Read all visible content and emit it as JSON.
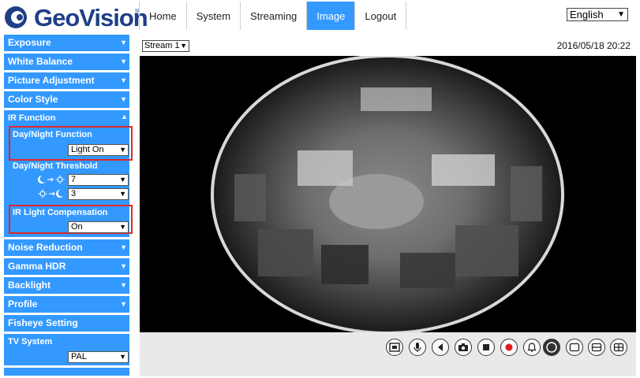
{
  "brand": {
    "name": "GeoVision",
    "suffix": "INC."
  },
  "nav": [
    {
      "label": "Home",
      "active": false
    },
    {
      "label": "System",
      "active": false
    },
    {
      "label": "Streaming",
      "active": false
    },
    {
      "label": "Image",
      "active": true
    },
    {
      "label": "Logout",
      "active": false
    }
  ],
  "language": {
    "selected": "English"
  },
  "sidebar": {
    "exposure": "Exposure",
    "white_balance": "White Balance",
    "picture_adjustment": "Picture Adjustment",
    "color_style": "Color Style",
    "ir_function": {
      "title": "IR Function",
      "day_night_function_label": "Day/Night Function",
      "day_night_function_value": "Light On",
      "day_night_threshold_label": "Day/Night Threshold",
      "night_to_day_value": "7",
      "day_to_night_value": "3",
      "ir_light_compensation_label": "IR Light Compensation",
      "ir_light_compensation_value": "On"
    },
    "noise_reduction": "Noise Reduction",
    "gamma_hdr": "Gamma HDR",
    "backlight": "Backlight",
    "profile": "Profile",
    "fisheye_setting": "Fisheye Setting",
    "tv_system": {
      "title": "TV System",
      "value": "PAL"
    }
  },
  "stream": {
    "selected": "Stream 1"
  },
  "datetime": "2016/05/18 20:22",
  "colors": {
    "accent": "#3399ff",
    "highlight": "#e0262c",
    "brand": "#1f3f86"
  },
  "toolbar_icons": [
    "fullscreen-icon",
    "microphone-icon",
    "speaker-icon",
    "camera-icon",
    "stop-icon",
    "record-icon",
    "alarm-icon",
    "fisheye-view-icon",
    "single-view-icon",
    "dual-view-icon",
    "quad-view-icon"
  ]
}
